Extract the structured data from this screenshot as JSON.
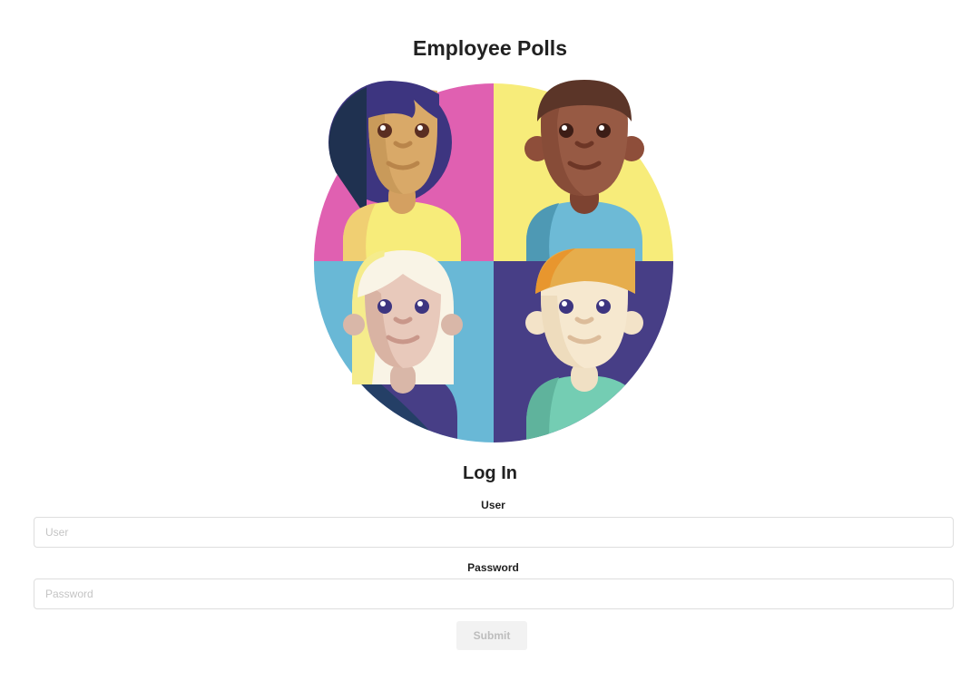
{
  "app": {
    "title": "Employee Polls",
    "illustration_icon": "four-employee-avatars-icon"
  },
  "login": {
    "heading": "Log In",
    "user_label": "User",
    "user_placeholder": "User",
    "user_value": "",
    "password_label": "Password",
    "password_placeholder": "Password",
    "password_value": "",
    "submit_label": "Submit"
  },
  "colors": {
    "pink": "#e060b1",
    "yellow": "#f7ec7a",
    "blue": "#69b8d6",
    "purple": "#473e86",
    "submit_bg": "#f2f2f2"
  }
}
